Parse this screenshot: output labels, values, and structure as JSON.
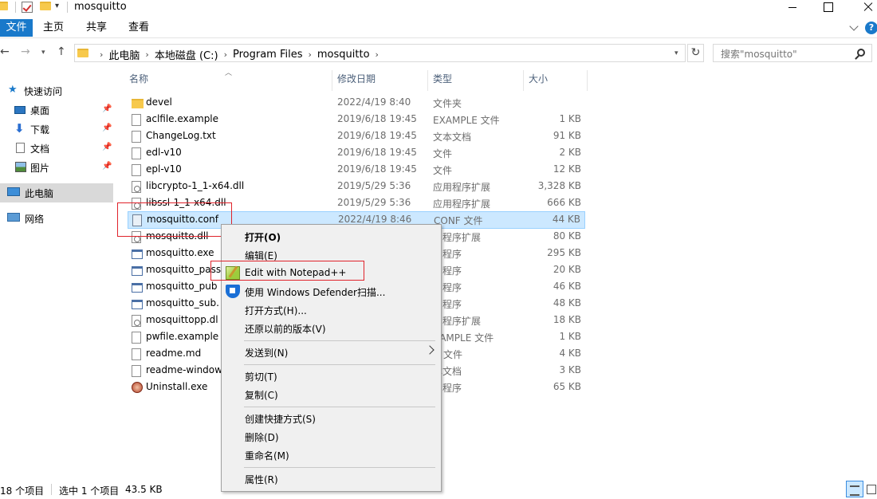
{
  "window": {
    "title": "mosquitto"
  },
  "ribbon": {
    "tabs": [
      "文件",
      "主页",
      "共享",
      "查看"
    ]
  },
  "address": {
    "breadcrumbs": [
      "此电脑",
      "本地磁盘 (C:)",
      "Program Files",
      "mosquitto"
    ]
  },
  "search": {
    "placeholder": "搜索\"mosquitto\""
  },
  "sidebar": {
    "quick_access": "快速访问",
    "desktop": "桌面",
    "downloads": "下载",
    "documents": "文档",
    "pictures": "图片",
    "this_pc": "此电脑",
    "network": "网络"
  },
  "columns": {
    "name": "名称",
    "date": "修改日期",
    "type": "类型",
    "size": "大小"
  },
  "files": [
    {
      "name": "devel",
      "date": "2022/4/19 8:40",
      "type": "文件夹",
      "size": "",
      "icon": "folder-icon"
    },
    {
      "name": "aclfile.example",
      "date": "2019/6/18 19:45",
      "type": "EXAMPLE 文件",
      "size": "1 KB",
      "icon": "file-icon"
    },
    {
      "name": "ChangeLog.txt",
      "date": "2019/6/18 19:45",
      "type": "文本文档",
      "size": "91 KB",
      "icon": "file-icon"
    },
    {
      "name": "edl-v10",
      "date": "2019/6/18 19:45",
      "type": "文件",
      "size": "2 KB",
      "icon": "file-icon"
    },
    {
      "name": "epl-v10",
      "date": "2019/6/18 19:45",
      "type": "文件",
      "size": "12 KB",
      "icon": "file-icon"
    },
    {
      "name": "libcrypto-1_1-x64.dll",
      "date": "2019/5/29 5:36",
      "type": "应用程序扩展",
      "size": "3,328 KB",
      "icon": "dll-icon"
    },
    {
      "name": "libssl-1_1-x64.dll",
      "date": "2019/5/29 5:36",
      "type": "应用程序扩展",
      "size": "666 KB",
      "icon": "dll-icon"
    },
    {
      "name": "mosquitto.conf",
      "date": "2022/4/19 8:46",
      "type": "CONF 文件",
      "size": "44 KB",
      "icon": "conf-file-icon"
    },
    {
      "name": "mosquitto.dll",
      "date": "",
      "type": "用程序扩展",
      "size": "80 KB",
      "icon": "dll-icon"
    },
    {
      "name": "mosquitto.exe",
      "date": "",
      "type": "用程序",
      "size": "295 KB",
      "icon": "exe-icon"
    },
    {
      "name": "mosquitto_pass",
      "date": "",
      "type": "用程序",
      "size": "20 KB",
      "icon": "exe-icon"
    },
    {
      "name": "mosquitto_pub",
      "date": "",
      "type": "用程序",
      "size": "46 KB",
      "icon": "exe-icon"
    },
    {
      "name": "mosquitto_sub.",
      "date": "",
      "type": "用程序",
      "size": "48 KB",
      "icon": "exe-icon"
    },
    {
      "name": "mosquittopp.dl",
      "date": "",
      "type": "用程序扩展",
      "size": "18 KB",
      "icon": "dll-icon"
    },
    {
      "name": "pwfile.example",
      "date": "",
      "type": "XAMPLE 文件",
      "size": "1 KB",
      "icon": "file-icon"
    },
    {
      "name": "readme.md",
      "date": "",
      "type": "D 文件",
      "size": "4 KB",
      "icon": "file-icon"
    },
    {
      "name": "readme-window",
      "date": "",
      "type": "本文档",
      "size": "3 KB",
      "icon": "file-icon"
    },
    {
      "name": "Uninstall.exe",
      "date": "",
      "type": "用程序",
      "size": "65 KB",
      "icon": "uninstall-icon"
    }
  ],
  "context_menu": {
    "open": "打开(O)",
    "edit": "编辑(E)",
    "edit_npp": "Edit with Notepad++",
    "defender": "使用 Windows Defender扫描...",
    "open_with": "打开方式(H)...",
    "restore": "还原以前的版本(V)",
    "send_to": "发送到(N)",
    "cut": "剪切(T)",
    "copy": "复制(C)",
    "shortcut": "创建快捷方式(S)",
    "delete": "删除(D)",
    "rename": "重命名(M)",
    "properties": "属性(R)"
  },
  "status": {
    "count": "18 个项目",
    "selected": "选中 1 个项目",
    "size": "43.5 KB"
  },
  "colors": {
    "accent": "#1979ca",
    "selection": "#cce8ff",
    "annotation": "#e0232b"
  }
}
